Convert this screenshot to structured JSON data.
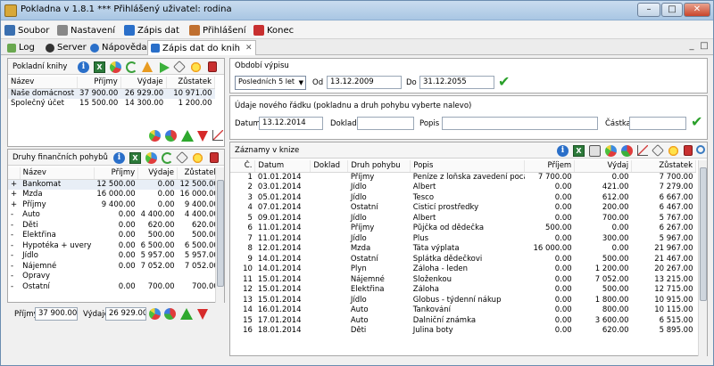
{
  "window": {
    "title": "Pokladna v 1.8.1 ***  Přihlášený uživatel: rodina"
  },
  "menu": [
    {
      "label": "Soubor",
      "icon": "floppy-icon",
      "color": "#3a6fb0"
    },
    {
      "label": "Nastavení",
      "icon": "tools-icon",
      "color": "#707070"
    },
    {
      "label": "Zápis dat",
      "icon": "pencil-icon",
      "color": "#2a6fc9"
    },
    {
      "label": "Přihlášení",
      "icon": "users-icon",
      "color": "#c07030"
    },
    {
      "label": "Konec",
      "icon": "exit-icon",
      "color": "#c83030"
    }
  ],
  "tabs": [
    {
      "label": "Log",
      "icon": "book-icon"
    },
    {
      "label": "Server",
      "icon": "gear-icon"
    },
    {
      "label": "Nápověda",
      "icon": "info-icon"
    },
    {
      "label": "Zápis dat do knih",
      "icon": "pencil-icon",
      "active": true
    }
  ],
  "books": {
    "title": "Pokladní knihy",
    "columns": [
      "Název",
      "Příjmy",
      "Výdaje",
      "Zůstatek"
    ],
    "rows": [
      [
        "Naše domácnost",
        "37 900.00",
        "26 929.00",
        "10 971.00"
      ],
      [
        "Společný účet",
        "15 500.00",
        "14 300.00",
        "1 200.00"
      ]
    ]
  },
  "categories": {
    "title": "Druhy finančních pohybů",
    "columns": [
      "",
      "Název",
      "Příjmy",
      "Výdaje",
      "Zůstatek"
    ],
    "rows": [
      [
        "+",
        "Bankomat",
        "12 500.00",
        "0.00",
        "12 500.00"
      ],
      [
        "+",
        "Mzda",
        "16 000.00",
        "0.00",
        "16 000.00"
      ],
      [
        "+",
        "Příjmy",
        "9 400.00",
        "0.00",
        "9 400.00"
      ],
      [
        "-",
        "Auto",
        "0.00",
        "4 400.00",
        "4 400.00"
      ],
      [
        "-",
        "Děti",
        "0.00",
        "620.00",
        "620.00"
      ],
      [
        "-",
        "Elektřina",
        "0.00",
        "500.00",
        "500.00"
      ],
      [
        "-",
        "Hypotéka + uvery",
        "0.00",
        "6 500.00",
        "6 500.00"
      ],
      [
        "-",
        "Jídlo",
        "0.00",
        "5 957.00",
        "5 957.00"
      ],
      [
        "-",
        "Nájemné",
        "0.00",
        "7 052.00",
        "7 052.00"
      ],
      [
        "-",
        "Opravy",
        "",
        "",
        ""
      ],
      [
        "-",
        "Ostatní",
        "0.00",
        "700.00",
        "700.00"
      ]
    ],
    "totals": {
      "prijmy_label": "Příjmy",
      "prijmy_value": "37 900.00",
      "vydaje_label": "Výdaje",
      "vydaje_value": "26 929.00"
    }
  },
  "period": {
    "title": "Období výpisu",
    "select_value": "Posledních 5 let",
    "from_label": "Od",
    "from_value": "13.12.2009",
    "to_label": "Do",
    "to_value": "31.12.2055"
  },
  "newrow": {
    "title": "Údaje nového řádku (pokladnu a druh pohybu vyberte nalevo)",
    "date_label": "Datum",
    "date_value": "13.12.2014",
    "doklad_label": "Doklad",
    "doklad_value": "",
    "popis_label": "Popis",
    "popis_value": "",
    "castka_label": "Částka",
    "castka_value": ""
  },
  "records": {
    "title": "Záznamy v knize",
    "columns": [
      "Č.",
      "Datum",
      "Doklad",
      "Druh pohybu",
      "Popis",
      "Příjem",
      "Výdaj",
      "Zůstatek"
    ],
    "rows": [
      [
        "1",
        "01.01.2014",
        "",
        "Příjmy",
        "Peníze z loňska zavedení pocatchího ...",
        "7 700.00",
        "0.00",
        "7 700.00"
      ],
      [
        "2",
        "03.01.2014",
        "",
        "Jídlo",
        "Albert",
        "0.00",
        "421.00",
        "7 279.00"
      ],
      [
        "3",
        "05.01.2014",
        "",
        "Jídlo",
        "Tesco",
        "0.00",
        "612.00",
        "6 667.00"
      ],
      [
        "4",
        "07.01.2014",
        "",
        "Ostatní",
        "Čisticí prostředky",
        "0.00",
        "200.00",
        "6 467.00"
      ],
      [
        "5",
        "09.01.2014",
        "",
        "Jídlo",
        "Albert",
        "0.00",
        "700.00",
        "5 767.00"
      ],
      [
        "6",
        "11.01.2014",
        "",
        "Příjmy",
        "Půjčka od dědečka",
        "500.00",
        "0.00",
        "6 267.00"
      ],
      [
        "7",
        "11.01.2014",
        "",
        "Jídlo",
        "Plus",
        "0.00",
        "300.00",
        "5 967.00"
      ],
      [
        "8",
        "12.01.2014",
        "",
        "Mzda",
        "Táta výplata",
        "16 000.00",
        "0.00",
        "21 967.00"
      ],
      [
        "9",
        "14.01.2014",
        "",
        "Ostatní",
        "Splátka dědečkovi",
        "0.00",
        "500.00",
        "21 467.00"
      ],
      [
        "10",
        "14.01.2014",
        "",
        "Plyn",
        "Záloha - leden",
        "0.00",
        "1 200.00",
        "20 267.00"
      ],
      [
        "11",
        "15.01.2014",
        "",
        "Nájemné",
        "Složenkou",
        "0.00",
        "7 052.00",
        "13 215.00"
      ],
      [
        "12",
        "15.01.2014",
        "",
        "Elektřina",
        "Záloha",
        "0.00",
        "500.00",
        "12 715.00"
      ],
      [
        "13",
        "15.01.2014",
        "",
        "Jídlo",
        "Globus - týdenní nákup",
        "0.00",
        "1 800.00",
        "10 915.00"
      ],
      [
        "14",
        "16.01.2014",
        "",
        "Auto",
        "Tankování",
        "0.00",
        "800.00",
        "10 115.00"
      ],
      [
        "15",
        "17.01.2014",
        "",
        "Auto",
        "Dalniční známka",
        "0.00",
        "3 600.00",
        "6 515.00"
      ],
      [
        "16",
        "18.01.2014",
        "",
        "Děti",
        "Julina boty",
        "0.00",
        "620.00",
        "5 895.00"
      ]
    ]
  }
}
